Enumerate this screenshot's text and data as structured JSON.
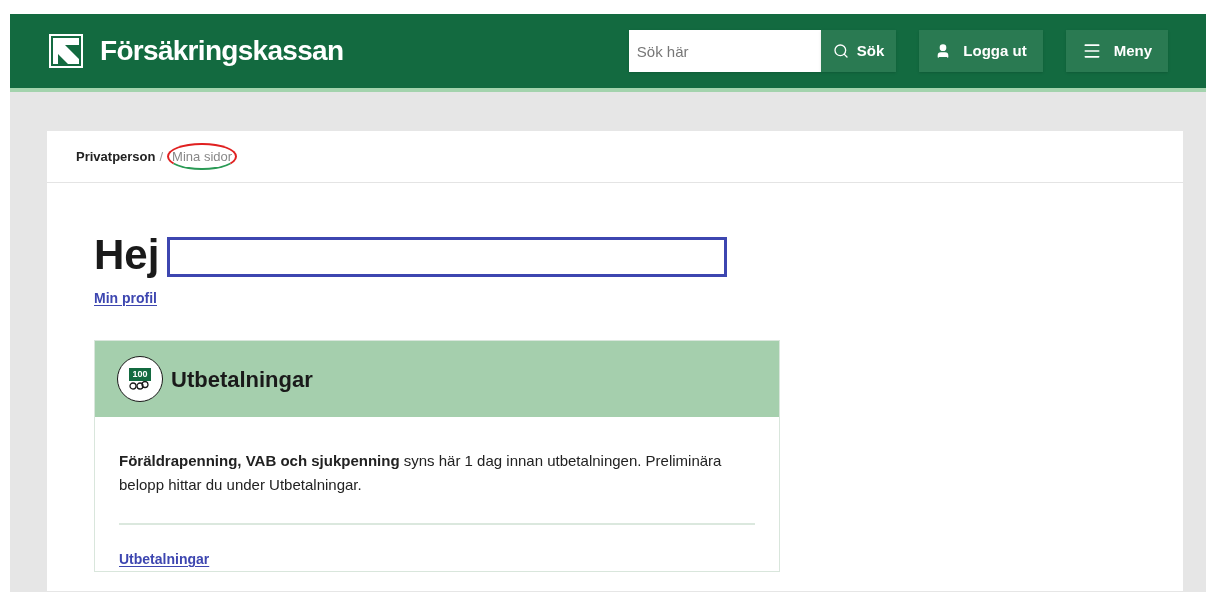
{
  "header": {
    "brand": "Försäkringskassan",
    "search": {
      "placeholder": "Sök här",
      "button": "Sök"
    },
    "buttons": [
      {
        "kind": "user",
        "label": "Logga ut"
      },
      {
        "kind": "menu",
        "label": "Meny"
      }
    ]
  },
  "breadcrumb_separator": "/",
  "breadcrumbs": [
    {
      "label": "Privatperson",
      "selected": false
    },
    {
      "label": "Mina sidor",
      "selected": true
    }
  ],
  "greeting": "Hej",
  "profile_link": "Min profil",
  "card": {
    "title": "Utbetalningar",
    "icon_text": "100",
    "text": "**Föräldrapenning, VAB och sjukpenning** syns här 1 dag innan utbetalningen. Preliminära belopp hittar du under Utbetalningar.",
    "link": "Utbetalningar"
  }
}
